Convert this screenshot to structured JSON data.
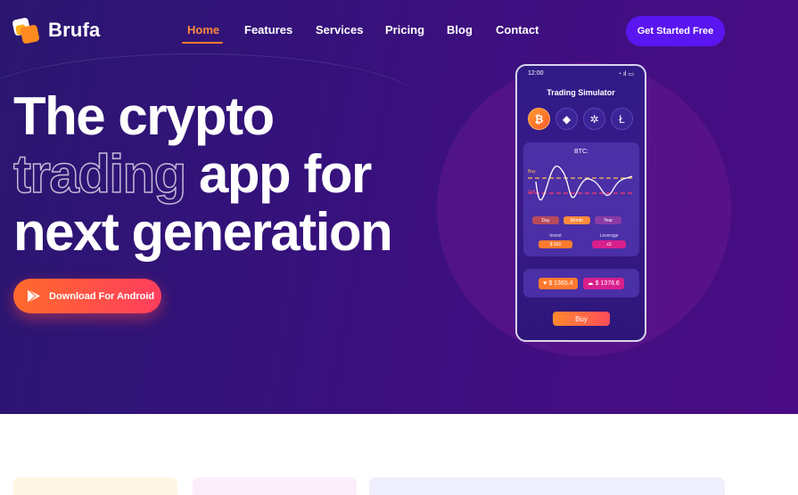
{
  "brand": {
    "name": "Brufa"
  },
  "nav": {
    "items": [
      {
        "label": "Home",
        "active": true
      },
      {
        "label": "Features"
      },
      {
        "label": "Services"
      },
      {
        "label": "Pricing"
      },
      {
        "label": "Blog"
      },
      {
        "label": "Contact"
      }
    ],
    "cta": "Get Started Free"
  },
  "hero": {
    "line1": "The crypto",
    "line2_outline": "trading",
    "line2_rest": " app for",
    "line3": "next generation",
    "android_button": "Download For Android"
  },
  "phone": {
    "time": "12:00",
    "title": "Trading Simulator",
    "coins": [
      "bitcoin-icon",
      "ethereum-icon",
      "ripple-icon",
      "litecoin-icon"
    ],
    "chart_label": "BTC:",
    "buy_label": "Buy",
    "sell_label": "Sell",
    "periods": [
      "Day",
      "Month",
      "Year"
    ],
    "invest_label": "Invest",
    "invest_value": "$ 650",
    "leverage_label": "Leverage",
    "leverage_value": "x3",
    "balance_up": "$ 1365.4",
    "balance_down": "$ 1378.6",
    "buy_button": "Buy"
  },
  "colors": {
    "accent_orange": "#ff7a2e",
    "cta_purple": "#5a15f0",
    "hero_bg": "#34127a"
  }
}
